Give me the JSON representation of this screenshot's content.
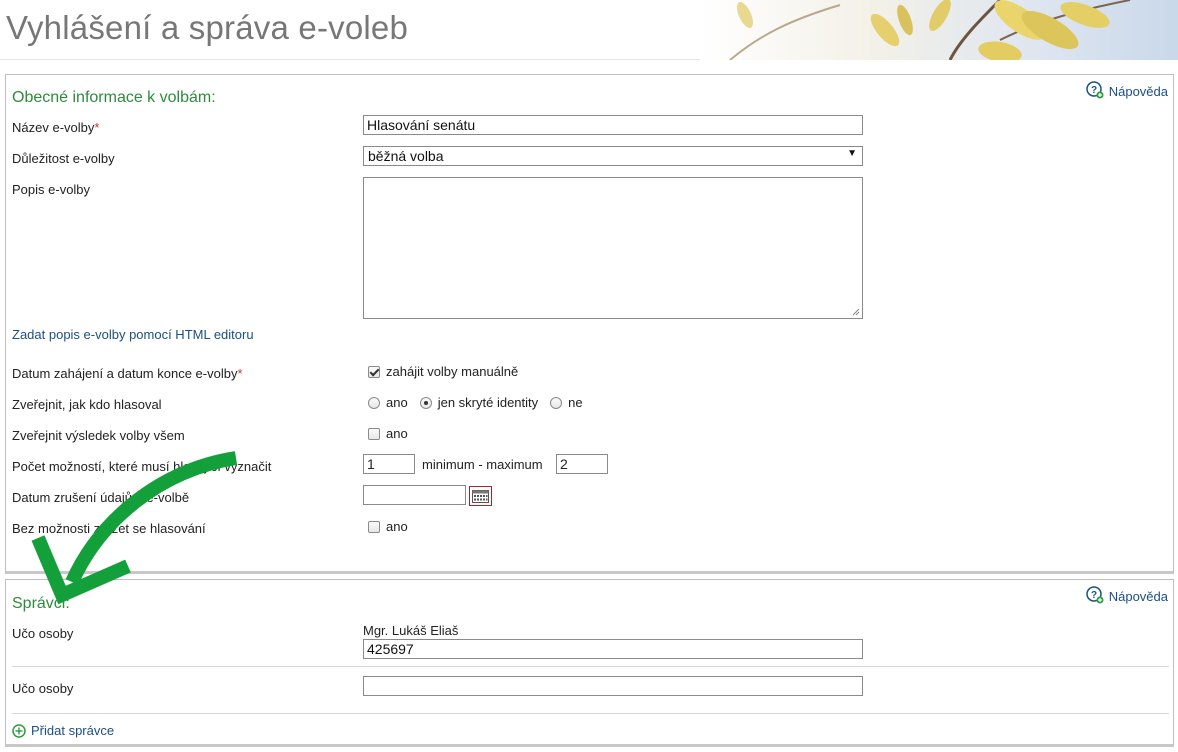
{
  "header": {
    "title": "Vyhlášení a správa e-voleb"
  },
  "general": {
    "title": "Obecné informace k volbám:",
    "help": "Nápověda",
    "name_label": "Název e-volby",
    "name_required": "*",
    "name_value": "Hlasování senátu",
    "importance_label": "Důležitost e-volby",
    "importance_value": "běžná volba",
    "description_label": "Popis e-volby",
    "html_editor_link": "Zadat popis e-volby pomocí HTML editoru",
    "dates_label": "Datum zahájení a datum konce e-volby",
    "dates_required": "*",
    "manual_start_label": "zahájit volby manuálně",
    "manual_start_checked": true,
    "publish_who_label": "Zveřejnit, jak kdo hlasoval",
    "publish_who_options": [
      "ano",
      "jen skryté identity",
      "ne"
    ],
    "publish_who_selected": "jen skryté identity",
    "publish_result_label": "Zveřejnit výsledek volby všem",
    "publish_result_option": "ano",
    "count_label": "Počet možností, které musí hlasující vyznačit",
    "count_min": "1",
    "count_between": "minimum - maximum",
    "count_max": "2",
    "cancel_date_label": "Datum zrušení údajů o e-volbě",
    "cancel_date_value": "",
    "abstain_label": "Bez možnosti zdržet se hlasování",
    "abstain_option": "ano"
  },
  "admins": {
    "title": "Správci:",
    "help": "Nápověda",
    "rows": [
      {
        "label": "Učo osoby",
        "person": "Mgr. Lukáš Eliaš",
        "value": "425697"
      },
      {
        "label": "Učo osoby",
        "person": "",
        "value": ""
      }
    ],
    "add_label": "Přidat správce"
  },
  "colors": {
    "section_title": "#2e8b3e",
    "link": "#1b4f85",
    "annotation_arrow": "#13a03a"
  },
  "icons": [
    "help-icon",
    "calendar-icon",
    "add-circle-icon",
    "curved-arrow-annotation"
  ]
}
